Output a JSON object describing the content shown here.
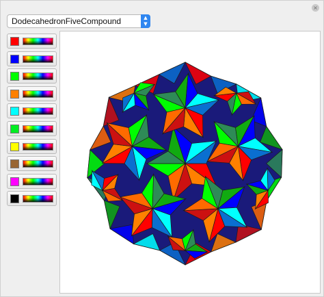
{
  "window": {
    "close_glyph": "×"
  },
  "select": {
    "value": "DodecahedronFiveCompound",
    "arrow_glyph": "▲▼"
  },
  "swatches": [
    {
      "color": "#ff0000"
    },
    {
      "color": "#0000ff"
    },
    {
      "color": "#00ff00"
    },
    {
      "color": "#ff8000"
    },
    {
      "color": "#00ffff"
    },
    {
      "color": "#00ee22"
    },
    {
      "color": "#ffff00"
    },
    {
      "color": "#996633"
    },
    {
      "color": "#ff00ff"
    },
    {
      "color": "#000000"
    }
  ],
  "polyhedron": {
    "name": "DodecahedronFiveCompound",
    "face_colors": [
      "#ff0000",
      "#0000ff",
      "#00ff00",
      "#ff8000",
      "#00ffff",
      "#2e8b57",
      "#cc1111",
      "#0a6fd0",
      "#11aa11",
      "#ff6a00"
    ]
  }
}
